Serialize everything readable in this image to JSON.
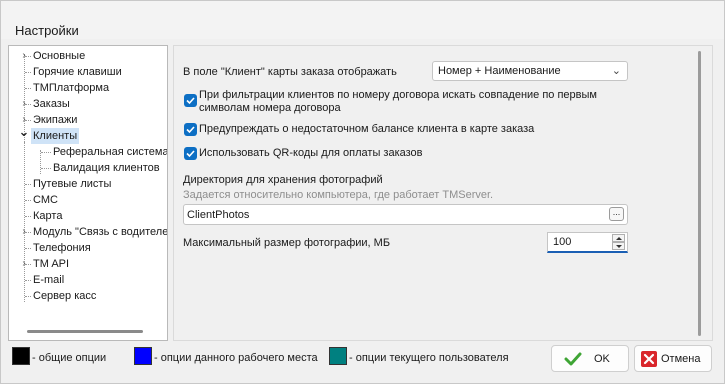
{
  "window": {
    "title": "Настройки"
  },
  "tree": {
    "items": [
      {
        "label": "Основные",
        "expander": "›"
      },
      {
        "label": "Горячие клавиши"
      },
      {
        "label": "ТМПлатформа"
      },
      {
        "label": "Заказы",
        "expander": "›"
      },
      {
        "label": "Экипажи",
        "expander": "›"
      },
      {
        "label": "Клиенты",
        "expander": "⌄",
        "selected": true
      },
      {
        "label": "Реферальная система"
      },
      {
        "label": "Валидация клиентов"
      },
      {
        "label": "Путевые листы"
      },
      {
        "label": "СМС"
      },
      {
        "label": "Карта"
      },
      {
        "label": "Модуль \"Связь с водителем\"",
        "expander": "›"
      },
      {
        "label": "Телефония"
      },
      {
        "label": "TM API",
        "expander": "›"
      },
      {
        "label": "E-mail"
      },
      {
        "label": "Сервер касс"
      }
    ]
  },
  "settings": {
    "client_display_label": "В поле \"Клиент\" карты заказа отображать",
    "client_display_value": "Номер + Наименование",
    "chk_contract_search_line1": "При фильтрации клиентов по номеру договора искать совпадение по первым",
    "chk_contract_search_line2": "символам номера договора",
    "chk_balance_warning": "Предупреждать о недостаточном балансе клиента в карте заказа",
    "chk_qr_codes": "Использовать QR-коды для оплаты заказов",
    "photo_dir_label": "Директория для хранения фотографий",
    "photo_dir_hint": "Задается относительно  компьютера, где работает TMServer.",
    "photo_dir_value": "ClientPhotos",
    "ellipsis_label": "...",
    "max_photo_label": "Максимальный размер фотографии, МБ",
    "max_photo_value": "100"
  },
  "legend": {
    "common": {
      "label": "- общие опции",
      "color": "#000000"
    },
    "workplace": {
      "label": "- опции данного рабочего места",
      "color": "#0000ff"
    },
    "user": {
      "label": "- опции текущего пользователя",
      "color": "#008080"
    }
  },
  "buttons": {
    "ok": "OK",
    "cancel": "Отмена"
  },
  "colors": {
    "accent": "#0d6fc4",
    "selection": "#cfe3f7",
    "ok_icon": "#3fa535",
    "cancel_icon": "#d9262b"
  },
  "icons": {
    "ok": "checkmark-icon",
    "cancel": "cross-icon",
    "checkbox": "check-icon"
  }
}
